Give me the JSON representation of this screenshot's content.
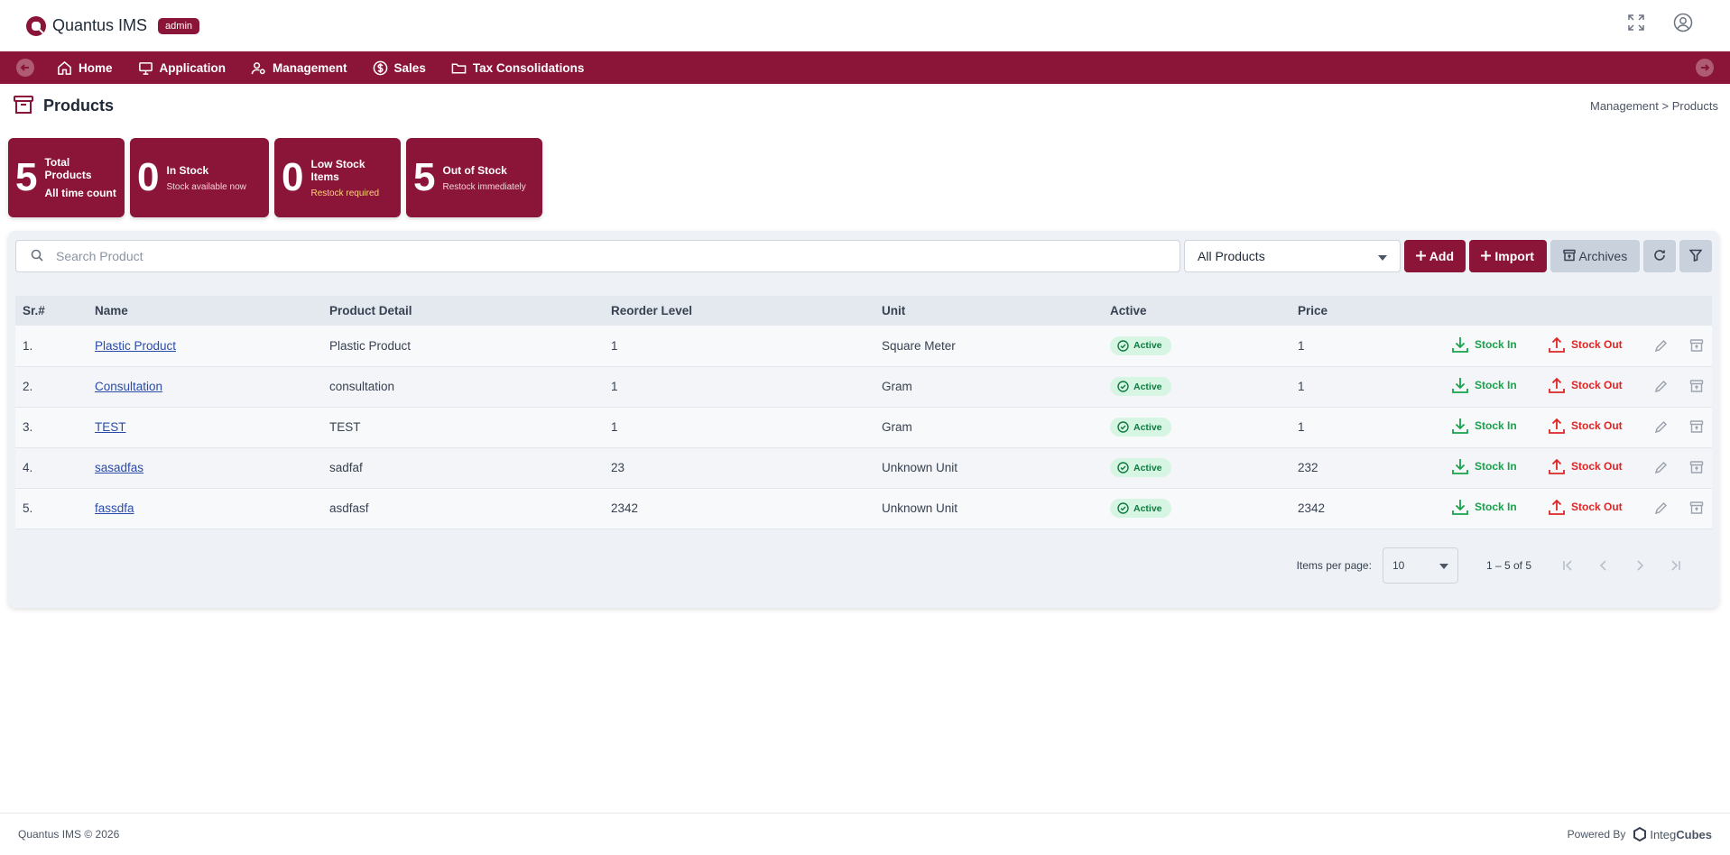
{
  "app": {
    "title": "Quantus IMS",
    "role_badge": "admin"
  },
  "nav": {
    "items": [
      {
        "label": "Home",
        "icon": "home-icon"
      },
      {
        "label": "Application",
        "icon": "monitor-icon"
      },
      {
        "label": "Management",
        "icon": "users-gear-icon"
      },
      {
        "label": "Sales",
        "icon": "dollar-icon"
      },
      {
        "label": "Tax Consolidations",
        "icon": "folder-icon"
      }
    ]
  },
  "page": {
    "title": "Products",
    "breadcrumb": "Management > Products"
  },
  "stats": [
    {
      "value": "5",
      "label": "Total Products",
      "sub": "All time count"
    },
    {
      "value": "0",
      "label": "In Stock",
      "sub": "Stock available now"
    },
    {
      "value": "0",
      "label": "Low Stock Items",
      "sub": "Restock required"
    },
    {
      "value": "5",
      "label": "Out of Stock",
      "sub": "Restock immediately"
    }
  ],
  "toolbar": {
    "search_placeholder": "Search Product",
    "filter_value": "All Products",
    "add_label": "Add",
    "import_label": "Import",
    "archives_label": "Archives"
  },
  "table": {
    "headers": [
      "Sr.#",
      "Name",
      "Product Detail",
      "Reorder Level",
      "Unit",
      "Active",
      "Price"
    ],
    "stock_in_label": "Stock In",
    "stock_out_label": "Stock Out",
    "rows": [
      {
        "sr": "1.",
        "name": "Plastic Product",
        "detail": "Plastic Product",
        "reorder": "1",
        "unit": "Square Meter",
        "active": "Active",
        "price": "1"
      },
      {
        "sr": "2.",
        "name": "Consultation",
        "detail": "consultation",
        "reorder": "1",
        "unit": "Gram",
        "active": "Active",
        "price": "1"
      },
      {
        "sr": "3.",
        "name": "TEST",
        "detail": "TEST",
        "reorder": "1",
        "unit": "Gram",
        "active": "Active",
        "price": "1"
      },
      {
        "sr": "4.",
        "name": "sasadfas",
        "detail": "sadfaf",
        "reorder": "23",
        "unit": "Unknown Unit",
        "active": "Active",
        "price": "232"
      },
      {
        "sr": "5.",
        "name": "fassdfa",
        "detail": "asdfasf",
        "reorder": "2342",
        "unit": "Unknown Unit",
        "active": "Active",
        "price": "2342"
      }
    ]
  },
  "pagination": {
    "label": "Items per page:",
    "page_size": "10",
    "range": "1 – 5 of 5"
  },
  "footer": {
    "copyright": "Quantus IMS © 2026",
    "powered_by": "Powered By",
    "brand_a": "Integ",
    "brand_b": "Cubes"
  },
  "colors": {
    "brand": "#8b1538",
    "active_bg": "#d6f5e3",
    "stock_in": "#16a34a",
    "stock_out": "#dc2626"
  }
}
